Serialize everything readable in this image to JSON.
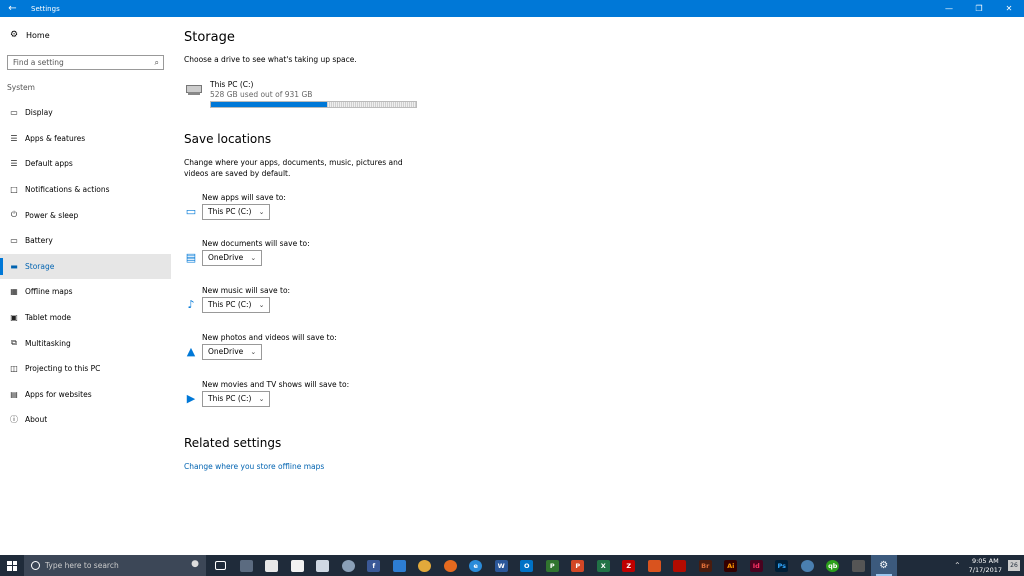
{
  "window": {
    "title": "Settings"
  },
  "sidebar": {
    "home_label": "Home",
    "search_placeholder": "Find a setting",
    "section": "System",
    "items": [
      {
        "label": "Display",
        "icon": "monitor-icon"
      },
      {
        "label": "Apps & features",
        "icon": "list-icon"
      },
      {
        "label": "Default apps",
        "icon": "list-check-icon"
      },
      {
        "label": "Notifications & actions",
        "icon": "message-icon"
      },
      {
        "label": "Power & sleep",
        "icon": "power-icon"
      },
      {
        "label": "Battery",
        "icon": "battery-icon"
      },
      {
        "label": "Storage",
        "icon": "drive-icon",
        "active": true
      },
      {
        "label": "Offline maps",
        "icon": "map-icon"
      },
      {
        "label": "Tablet mode",
        "icon": "tablet-icon"
      },
      {
        "label": "Multitasking",
        "icon": "multitask-icon"
      },
      {
        "label": "Projecting to this PC",
        "icon": "project-icon"
      },
      {
        "label": "Apps for websites",
        "icon": "web-apps-icon"
      },
      {
        "label": "About",
        "icon": "info-icon"
      }
    ]
  },
  "main": {
    "title": "Storage",
    "subtitle": "Choose a drive to see what's taking up space.",
    "drive": {
      "name": "This PC (C:)",
      "usage": "528 GB used out of 931 GB",
      "used_fraction": 0.567
    },
    "save_locations": {
      "heading": "Save locations",
      "description": "Change where your apps, documents, music, pictures and videos are saved by default.",
      "items": [
        {
          "label": "New apps will save to:",
          "value": "This PC (C:)",
          "icon": "apps-icon"
        },
        {
          "label": "New documents will save to:",
          "value": "OneDrive",
          "icon": "documents-icon"
        },
        {
          "label": "New music will save to:",
          "value": "This PC (C:)",
          "icon": "music-icon"
        },
        {
          "label": "New photos and videos will save to:",
          "value": "OneDrive",
          "icon": "photos-icon"
        },
        {
          "label": "New movies and TV shows will save to:",
          "value": "This PC (C:)",
          "icon": "video-icon"
        }
      ]
    },
    "related": {
      "heading": "Related settings",
      "link": "Change where you store offline maps"
    }
  },
  "taskbar": {
    "search_placeholder": "Type here to search",
    "time": "9:05 AM",
    "date": "7/17/2017",
    "notification_count": "26",
    "accent": "#0078d7"
  }
}
